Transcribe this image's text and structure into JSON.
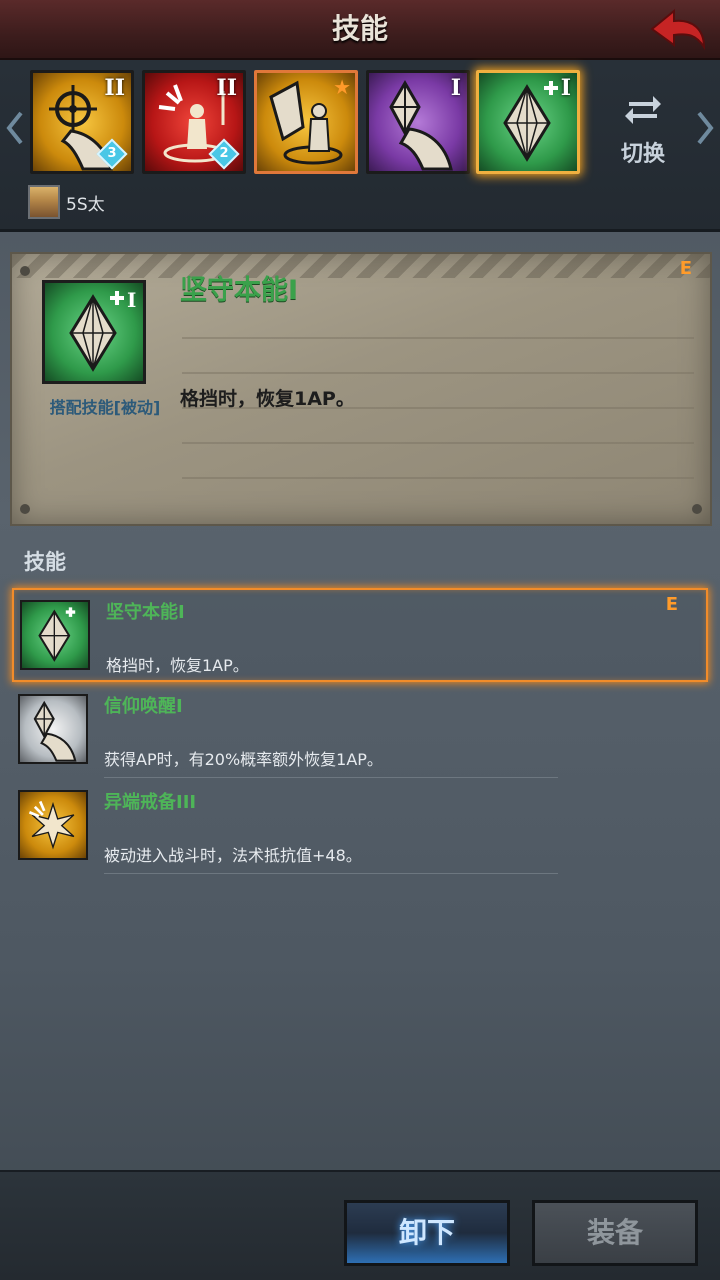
{
  "header": {
    "title": "技能"
  },
  "strip": {
    "slots": [
      {
        "roman": "II",
        "count": "3",
        "color": "#f0b030",
        "icon": "crosshair-hand-icon"
      },
      {
        "roman": "II",
        "count": "2",
        "color": "#d02020",
        "icon": "burst-figure-icon"
      },
      {
        "roman": "",
        "count": "",
        "color": "#e0a020",
        "icon": "shield-figure-icon",
        "star": true
      },
      {
        "roman": "I",
        "count": "",
        "color": "#8a42b5",
        "icon": "crystal-hand-icon"
      },
      {
        "roman": "I",
        "count": "",
        "color": "#35a654",
        "icon": "crystal-plus-icon",
        "selected": true
      }
    ],
    "switch_label": "切换",
    "owner_name": "5S太"
  },
  "detail": {
    "title": "坚守本能I",
    "grade": "E",
    "type_label": "搭配技能[被动]",
    "description": "格挡时，恢复1AP。"
  },
  "list": {
    "section_label": "技能",
    "items": [
      {
        "name": "坚守本能I",
        "desc": "格挡时，恢复1AP。",
        "grade": "E",
        "icon": "crystal-plus-icon"
      },
      {
        "name": "信仰唤醒I",
        "desc": "获得AP时，有20%概率额外恢复1AP。",
        "grade": "",
        "icon": "crystal-hand-icon"
      },
      {
        "name": "异端戒备III",
        "desc": "被动进入战斗时，法术抵抗值+48。",
        "grade": "",
        "icon": "burst-icon"
      }
    ]
  },
  "footer": {
    "unequip_label": "卸下",
    "equip_label": "装备"
  }
}
